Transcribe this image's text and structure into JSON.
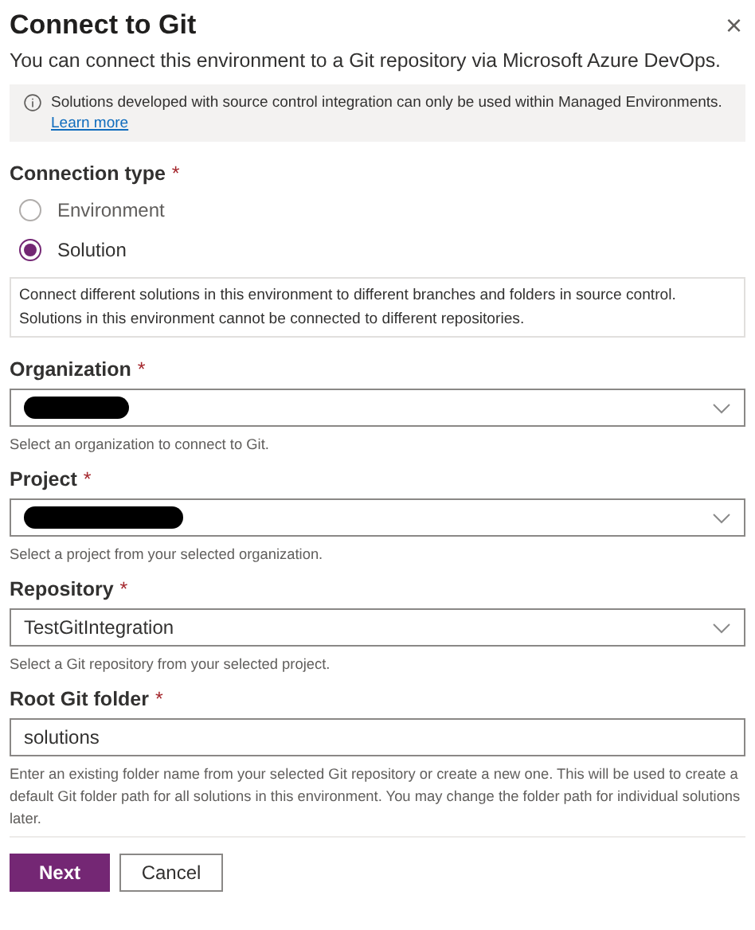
{
  "dialog": {
    "title": "Connect to Git",
    "subtitle": "You can connect this environment to a Git repository via Microsoft Azure DevOps.",
    "close_button": "×"
  },
  "info_bar": {
    "text": "Solutions developed with source control integration can only be used within Managed Environments.",
    "link": "Learn more"
  },
  "connection_type": {
    "label": "Connection type",
    "required_mark": "*",
    "options": [
      {
        "label": "Environment",
        "selected": false
      },
      {
        "label": "Solution",
        "selected": true
      }
    ],
    "description": "Connect different solutions in this environment to different branches and folders in source control. Solutions in this environment cannot be connected to different repositories."
  },
  "fields": [
    {
      "kind": "dropdown",
      "label": "Organization",
      "required_mark": "*",
      "redacted": true,
      "hint": "Select an organization to connect to Git."
    },
    {
      "kind": "dropdown",
      "label": "Project",
      "required_mark": "*",
      "redacted": true,
      "hint": "Select a project from your selected organization."
    },
    {
      "kind": "dropdown",
      "label": "Repository",
      "required_mark": "*",
      "value": "TestGitIntegration",
      "hint": "Select a Git repository from your selected project."
    },
    {
      "kind": "text",
      "label": "Root Git folder",
      "required_mark": "*",
      "value": "solutions",
      "hint": "Enter an existing folder name from your selected Git repository or create a new one. This will be used to create a default Git folder path for all solutions in this environment. You may change the folder path for individual solutions later."
    }
  ],
  "buttons": [
    {
      "label": "Next",
      "kind": "primary"
    },
    {
      "label": "Cancel",
      "kind": "secondary"
    }
  ]
}
